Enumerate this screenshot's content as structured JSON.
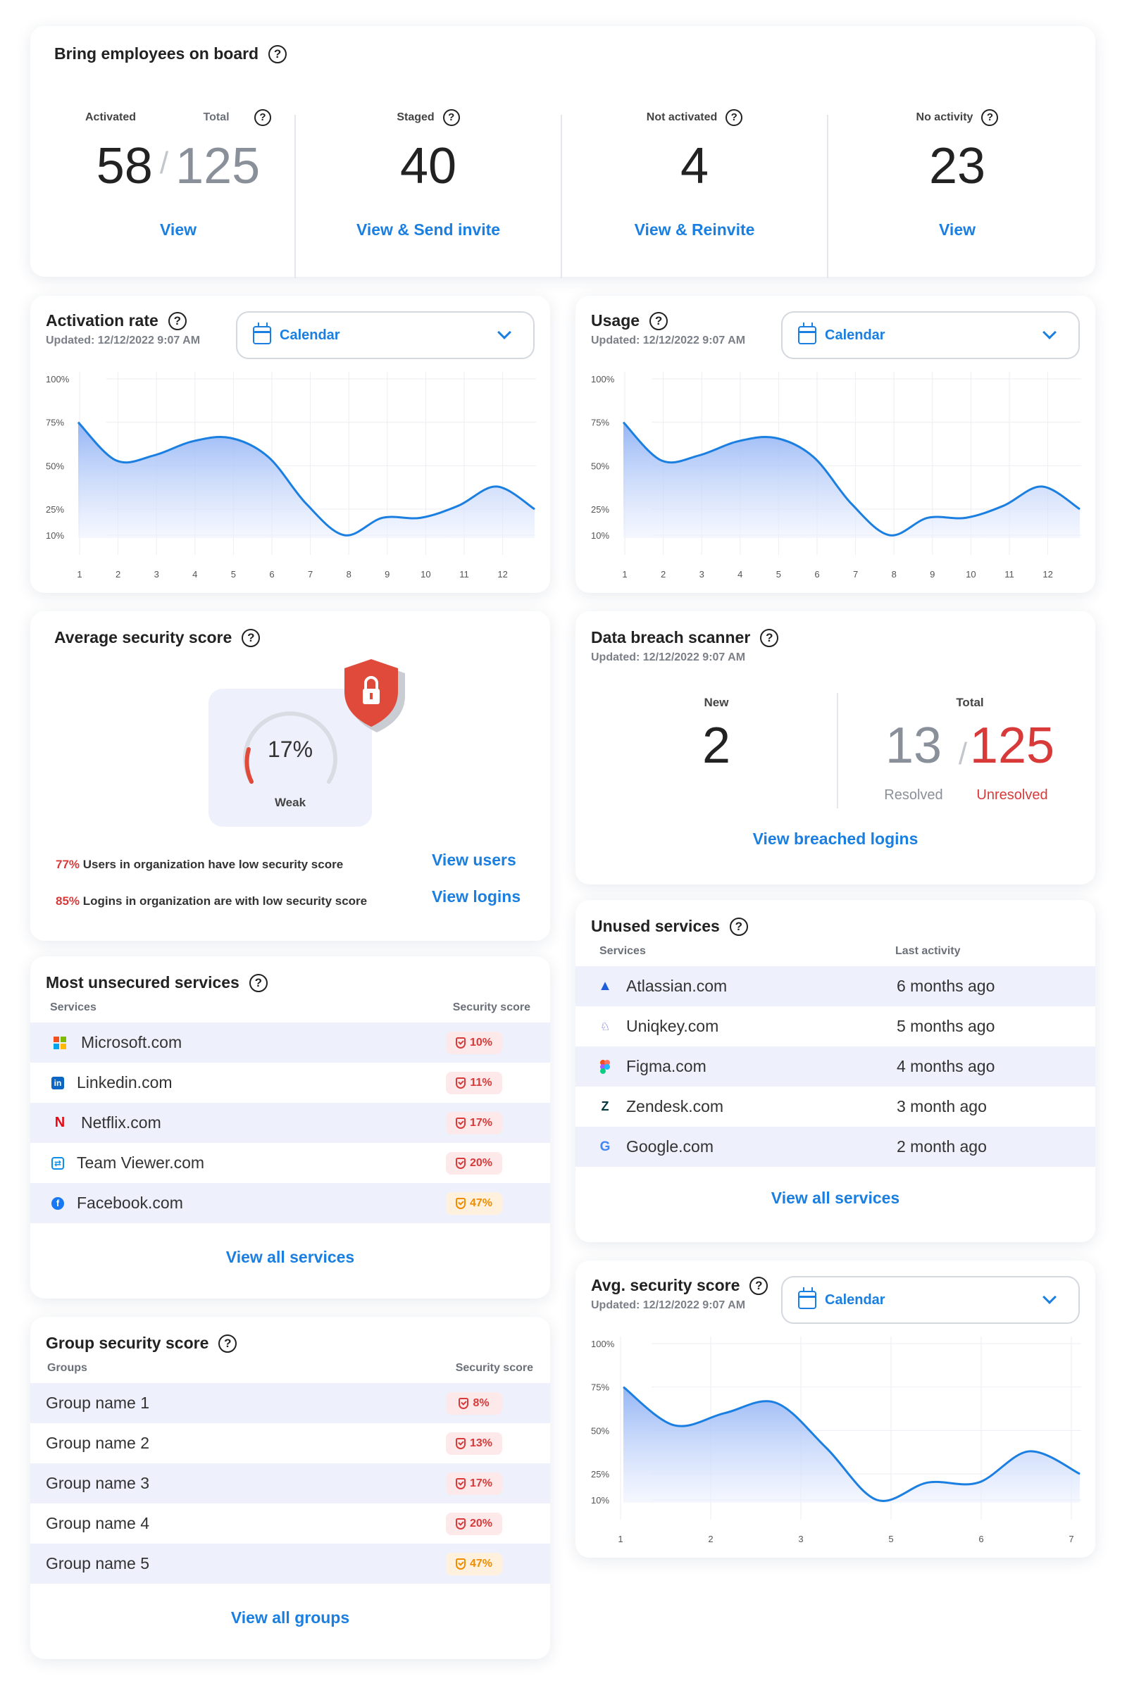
{
  "onboarding": {
    "title": "Bring employees on board",
    "activated_label": "Activated",
    "total_label": "Total",
    "activated_value": "58",
    "total_value": "125",
    "staged_label": "Staged",
    "staged_value": "40",
    "not_activated_label": "Not activated",
    "not_activated_value": "4",
    "no_activity_label": "No activity",
    "no_activity_value": "23",
    "view_label": "View",
    "view_send_invite_label": "View & Send invite",
    "view_reinvite_label": "View & Reinvite",
    "view2_label": "View"
  },
  "activation_rate": {
    "title": "Activation rate",
    "updated": "Updated: 12/12/2022 9:07 AM",
    "dropdown": "Calendar"
  },
  "usage": {
    "title": "Usage",
    "updated": "Updated: 12/12/2022 9:07 AM",
    "dropdown": "Calendar"
  },
  "avg_security": {
    "title": "Average security score",
    "score": "17%",
    "level": "Weak",
    "stat1_pct": "77%",
    "stat1_text": " Users in organization have low security score",
    "stat1_link": "View users",
    "stat2_pct": "85%",
    "stat2_text": " Logins in organization are with low security score",
    "stat2_link": "View logins"
  },
  "breach": {
    "title": "Data breach scanner",
    "updated": "Updated: 12/12/2022 9:07 AM",
    "new_label": "New",
    "new_value": "2",
    "total_label": "Total",
    "resolved_value": "13",
    "unresolved_value": "125",
    "resolved_label": "Resolved",
    "unresolved_label": "Unresolved",
    "link": "View breached logins"
  },
  "unsecured": {
    "title": "Most unsecured services",
    "col1": "Services",
    "col2": "Security score",
    "rows": [
      {
        "name": "Microsoft.com",
        "score": "10%"
      },
      {
        "name": "Linkedin.com",
        "score": "11%"
      },
      {
        "name": "Netflix.com",
        "score": "17%"
      },
      {
        "name": "Team Viewer.com",
        "score": "20%"
      },
      {
        "name": "Facebook.com",
        "score": "47%"
      }
    ],
    "link": "View all services"
  },
  "unused": {
    "title": "Unused services",
    "col1": "Services",
    "col2": "Last activity",
    "rows": [
      {
        "name": "Atlassian.com",
        "last": "6 months ago"
      },
      {
        "name": "Uniqkey.com",
        "last": "5 months ago"
      },
      {
        "name": "Figma.com",
        "last": "4 months ago"
      },
      {
        "name": "Zendesk.com",
        "last": "3 month ago"
      },
      {
        "name": "Google.com",
        "last": "2 month ago"
      }
    ],
    "link": "View all services"
  },
  "groups": {
    "title": "Group security score",
    "col1": "Groups",
    "col2": "Security score",
    "rows": [
      {
        "name": "Group name 1",
        "score": "8%"
      },
      {
        "name": "Group name 2",
        "score": "13%"
      },
      {
        "name": "Group name 3",
        "score": "17%"
      },
      {
        "name": "Group name 4",
        "score": "20%"
      },
      {
        "name": "Group name 5",
        "score": "47%"
      }
    ],
    "link": "View all groups"
  },
  "avg_score_chart": {
    "title": "Avg. security score",
    "updated": "Updated: 12/12/2022 9:07 AM",
    "dropdown": "Calendar"
  },
  "colors": {
    "accent": "#1a7fe0",
    "danger": "#d83a3a",
    "warning": "#f08c00",
    "row_alt": "#eef1fb"
  },
  "chart_data": [
    {
      "type": "area",
      "id": "activation",
      "x": [
        1,
        2,
        3,
        4,
        5,
        6,
        7,
        8,
        9,
        10,
        11,
        12
      ],
      "ytick_labels": [
        "100%",
        "75%",
        "50%",
        "25%",
        "10%"
      ],
      "series": [
        {
          "values": [
            75,
            53,
            56,
            64,
            66,
            55,
            28,
            10,
            20,
            20,
            27,
            38,
            25
          ]
        }
      ],
      "ylim": [
        0,
        100
      ]
    },
    {
      "type": "area",
      "id": "usage",
      "x": [
        1,
        2,
        3,
        4,
        5,
        6,
        7,
        8,
        9,
        10,
        11,
        12
      ],
      "ytick_labels": [
        "100%",
        "75%",
        "50%",
        "25%",
        "10%"
      ],
      "series": [
        {
          "values": [
            75,
            53,
            56,
            64,
            66,
            55,
            28,
            10,
            20,
            20,
            27,
            38,
            25
          ]
        }
      ],
      "ylim": [
        0,
        100
      ]
    },
    {
      "type": "area",
      "id": "avgscore",
      "x": [
        1,
        2,
        3,
        5,
        6,
        7
      ],
      "ytick_labels": [
        "100%",
        "75%",
        "50%",
        "25%",
        "10%"
      ],
      "series": [
        {
          "values": [
            75,
            53,
            60,
            66,
            40,
            10,
            20,
            20,
            38,
            25
          ]
        }
      ],
      "ylim": [
        0,
        100
      ]
    }
  ]
}
